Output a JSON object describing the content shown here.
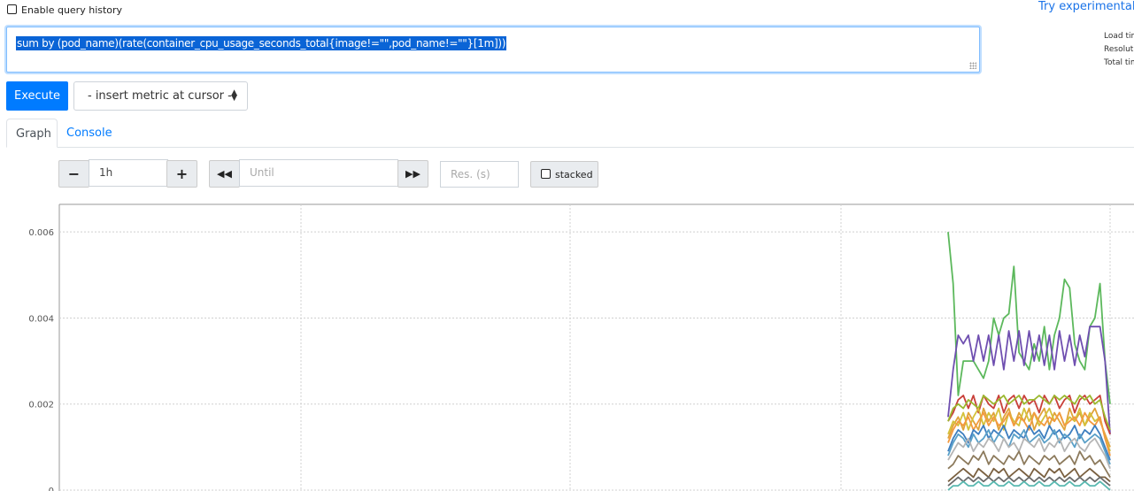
{
  "header": {
    "history_label": "Enable query history",
    "experimental_link": "Try experimental R",
    "stats": [
      "Load tim",
      "Resoluti",
      "Total tim"
    ]
  },
  "query": {
    "expression": "sum by (pod_name)(rate(container_cpu_usage_seconds_total{image!=\"\",pod_name!=\"\"}[1m]))"
  },
  "actions": {
    "execute_label": "Execute",
    "insert_metric_label": "- insert metric at cursor -"
  },
  "tabs": [
    {
      "label": "Graph",
      "active": true
    },
    {
      "label": "Console",
      "active": false
    }
  ],
  "controls": {
    "minus_label": "−",
    "range_value": "1h",
    "plus_label": "+",
    "back_label": "◀◀",
    "until_placeholder": "Until",
    "forward_label": "▶▶",
    "res_placeholder": "Res. (s)",
    "stacked_label": "stacked"
  },
  "colors": {
    "accent": "#007bff",
    "series": [
      "#5cb85c",
      "#6f4fb0",
      "#c9403a",
      "#9ab82e",
      "#e0a33a",
      "#d4c13a",
      "#f39a40",
      "#3d7ebf",
      "#5aa0c8",
      "#b5b5b5",
      "#8c7a5c",
      "#7a6040",
      "#6d6d6d",
      "#59b8b0"
    ]
  },
  "chart_data": {
    "type": "line",
    "y_ticks": [
      "0.006",
      "0.004",
      "0.002",
      "0"
    ],
    "ylim": [
      0,
      0.0066
    ],
    "grid": true,
    "series": [
      {
        "values": [
          0.006,
          0.0048,
          0.0022,
          0.003,
          0.003,
          0.003,
          0.0028,
          0.0026,
          0.003,
          0.004,
          0.0036,
          0.004,
          0.0041,
          0.0052,
          0.0032,
          0.003,
          0.0028,
          0.0034,
          0.003,
          0.0038,
          0.0028,
          0.0036,
          0.004,
          0.0049,
          0.0047,
          0.0034,
          0.003,
          0.0028,
          0.0038,
          0.004,
          0.0048,
          0.003,
          0.002
        ]
      },
      {
        "values": [
          0.0017,
          0.0028,
          0.0036,
          0.0034,
          0.0036,
          0.003,
          0.0036,
          0.003,
          0.0036,
          0.0029,
          0.0036,
          0.0028,
          0.0037,
          0.003,
          0.0037,
          0.0029,
          0.0037,
          0.003,
          0.0036,
          0.0029,
          0.0036,
          0.0028,
          0.0037,
          0.003,
          0.0036,
          0.0029,
          0.0036,
          0.0031,
          0.0038,
          0.0038,
          0.0038,
          0.003,
          0.0013
        ]
      },
      {
        "values": [
          0.0016,
          0.0018,
          0.0021,
          0.0022,
          0.0019,
          0.0022,
          0.0018,
          0.0022,
          0.002,
          0.0019,
          0.0022,
          0.0018,
          0.0021,
          0.0022,
          0.0019,
          0.0022,
          0.002,
          0.0021,
          0.0018,
          0.0022,
          0.002,
          0.0022,
          0.0019,
          0.0021,
          0.0022,
          0.0018,
          0.0021,
          0.0022,
          0.002,
          0.0021,
          0.0022,
          0.0016,
          0.0013
        ]
      },
      {
        "values": [
          0.0016,
          0.0019,
          0.002,
          0.0019,
          0.0021,
          0.002,
          0.0019,
          0.0022,
          0.0021,
          0.002,
          0.0021,
          0.0022,
          0.002,
          0.0021,
          0.0022,
          0.002,
          0.0021,
          0.0021,
          0.0022,
          0.0021,
          0.002,
          0.0022,
          0.0021,
          0.0022,
          0.0021,
          0.002,
          0.0022,
          0.0021,
          0.0022,
          0.002,
          0.0021,
          0.0017,
          0.0014
        ]
      },
      {
        "values": [
          0.0012,
          0.0015,
          0.0017,
          0.0014,
          0.0018,
          0.0016,
          0.0014,
          0.0019,
          0.0016,
          0.0018,
          0.0014,
          0.0017,
          0.0019,
          0.0015,
          0.0018,
          0.0016,
          0.0019,
          0.0014,
          0.0017,
          0.0019,
          0.0015,
          0.0018,
          0.0016,
          0.0014,
          0.0019,
          0.0016,
          0.0018,
          0.0015,
          0.0017,
          0.0019,
          0.0016,
          0.0013,
          0.001
        ]
      },
      {
        "values": [
          0.0013,
          0.0016,
          0.0015,
          0.0018,
          0.0014,
          0.0017,
          0.0019,
          0.0015,
          0.0018,
          0.0016,
          0.0019,
          0.0014,
          0.0018,
          0.0016,
          0.0015,
          0.0019,
          0.0016,
          0.0018,
          0.0015,
          0.0017,
          0.0019,
          0.0016,
          0.0018,
          0.0015,
          0.0017,
          0.0016,
          0.0019,
          0.0015,
          0.0018,
          0.0016,
          0.0017,
          0.0012,
          0.0009
        ]
      },
      {
        "values": [
          0.0011,
          0.0014,
          0.0016,
          0.0015,
          0.0017,
          0.0014,
          0.0016,
          0.0018,
          0.0015,
          0.0017,
          0.0015,
          0.0016,
          0.0018,
          0.0015,
          0.0017,
          0.0016,
          0.0014,
          0.0018,
          0.0016,
          0.0015,
          0.0017,
          0.0016,
          0.0018,
          0.0015,
          0.0016,
          0.0017,
          0.0015,
          0.0018,
          0.0016,
          0.0015,
          0.0017,
          0.0012,
          0.0008
        ]
      },
      {
        "values": [
          0.0009,
          0.0012,
          0.0014,
          0.0013,
          0.0011,
          0.0014,
          0.0013,
          0.0015,
          0.0012,
          0.0014,
          0.0013,
          0.0015,
          0.0012,
          0.0014,
          0.0013,
          0.0012,
          0.0015,
          0.0013,
          0.0014,
          0.0012,
          0.0015,
          0.0013,
          0.0014,
          0.0012,
          0.0013,
          0.0015,
          0.0012,
          0.0014,
          0.0013,
          0.0015,
          0.0013,
          0.001,
          0.0007
        ]
      },
      {
        "values": [
          0.0008,
          0.0011,
          0.0013,
          0.0012,
          0.001,
          0.0013,
          0.0011,
          0.0012,
          0.0014,
          0.0011,
          0.0013,
          0.0012,
          0.001,
          0.0013,
          0.0012,
          0.0014,
          0.0011,
          0.0012,
          0.0013,
          0.0011,
          0.0012,
          0.0014,
          0.0011,
          0.0013,
          0.0012,
          0.001,
          0.0013,
          0.0011,
          0.0012,
          0.0013,
          0.0012,
          0.0009,
          0.0006
        ]
      },
      {
        "values": [
          0.0007,
          0.0009,
          0.0011,
          0.001,
          0.0012,
          0.0009,
          0.0011,
          0.001,
          0.0012,
          0.0011,
          0.0009,
          0.0012,
          0.001,
          0.0011,
          0.0009,
          0.0012,
          0.0011,
          0.001,
          0.0012,
          0.0009,
          0.0011,
          0.001,
          0.0012,
          0.0009,
          0.0011,
          0.0012,
          0.001,
          0.0009,
          0.0011,
          0.0012,
          0.001,
          0.0008,
          0.0005
        ]
      },
      {
        "values": [
          0.0005,
          0.0006,
          0.0008,
          0.0007,
          0.0006,
          0.0008,
          0.0007,
          0.0009,
          0.0006,
          0.0008,
          0.0007,
          0.0006,
          0.0008,
          0.0007,
          0.0009,
          0.0006,
          0.0008,
          0.0007,
          0.0006,
          0.0008,
          0.0007,
          0.0008,
          0.0006,
          0.0007,
          0.0008,
          0.0006,
          0.0009,
          0.0007,
          0.0008,
          0.0006,
          0.0007,
          0.0005,
          0.0003
        ]
      },
      {
        "values": [
          0.0002,
          0.0003,
          0.0004,
          0.0005,
          0.0004,
          0.0003,
          0.0005,
          0.0004,
          0.0003,
          0.0005,
          0.0004,
          0.0005,
          0.0003,
          0.0004,
          0.0005,
          0.0004,
          0.0003,
          0.0005,
          0.0004,
          0.0003,
          0.0005,
          0.0004,
          0.0005,
          0.0003,
          0.0004,
          0.0005,
          0.0003,
          0.0004,
          0.0005,
          0.0004,
          0.0003,
          0.0003,
          0.0002
        ]
      },
      {
        "values": [
          0.0001,
          0.0002,
          0.0003,
          0.0002,
          0.0003,
          0.0002,
          0.0003,
          0.0002,
          0.0003,
          0.0002,
          0.0003,
          0.0002,
          0.0003,
          0.0002,
          0.0003,
          0.0002,
          0.0003,
          0.0002,
          0.0003,
          0.0002,
          0.0003,
          0.0002,
          0.0003,
          0.0002,
          0.0003,
          0.0002,
          0.0003,
          0.0002,
          0.0003,
          0.0002,
          0.0003,
          0.0002,
          0.0001
        ]
      },
      {
        "values": [
          0.0,
          0.0001,
          0.0001,
          0.0002,
          0.0001,
          0.0001,
          0.0002,
          0.0001,
          0.0001,
          0.0002,
          0.0001,
          0.0001,
          0.0002,
          0.0001,
          0.0001,
          0.0002,
          0.0001,
          0.0001,
          0.0002,
          0.0001,
          0.0001,
          0.0002,
          0.0001,
          0.0001,
          0.0002,
          0.0001,
          0.0001,
          0.0002,
          0.0001,
          0.0001,
          0.0002,
          0.0001,
          0.0
        ]
      }
    ]
  }
}
